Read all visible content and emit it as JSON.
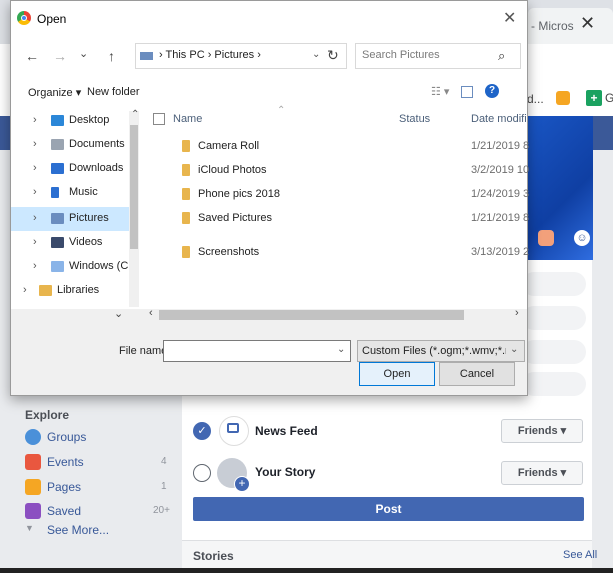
{
  "browser": {
    "tab_title": "- Micros",
    "tab_close": "✕",
    "bookmark_overflow": "d...",
    "bookmark_letter": "G"
  },
  "facebook": {
    "explore_header": "Explore",
    "nav": [
      {
        "label": "Groups",
        "count": "",
        "icon": "groups-icon",
        "color": "#4a90d9"
      },
      {
        "label": "Events",
        "count": "4",
        "icon": "calendar-icon",
        "color": "#e9573f"
      },
      {
        "label": "Pages",
        "count": "1",
        "icon": "flag-icon",
        "color": "#f5a623"
      },
      {
        "label": "Saved",
        "count": "20+",
        "icon": "bookmark-icon",
        "color": "#8b4fc1"
      },
      {
        "label": "See More...",
        "count": "",
        "icon": "chevron-down-icon",
        "color": "#90949c"
      }
    ],
    "share_rows": [
      {
        "label": "News Feed",
        "checked": true,
        "audience": "Friends ▾"
      },
      {
        "label": "Your Story",
        "checked": false,
        "audience": "Friends ▾"
      }
    ],
    "post_label": "Post",
    "stories_title": "Stories",
    "see_all": "See All",
    "accent": "#4267b2"
  },
  "dialog": {
    "title": "Open",
    "close_glyph": "✕",
    "nav": {
      "back": "←",
      "forward": "→",
      "recent": "⌄",
      "up": "↑"
    },
    "address_path": "›  This PC  ›  Pictures  ›",
    "search_placeholder": "Search Pictures",
    "organize": "Organize ▾",
    "new_folder": "New folder",
    "tree": [
      {
        "label": "Desktop",
        "icon": "desktop-icon",
        "color": "#2b87d8",
        "selected": false
      },
      {
        "label": "Documents",
        "icon": "documents-icon",
        "color": "#9aa4b1",
        "selected": false
      },
      {
        "label": "Downloads",
        "icon": "downloads-icon",
        "color": "#2b6fd1",
        "selected": false
      },
      {
        "label": "Music",
        "icon": "music-icon",
        "color": "#2b6fd1",
        "selected": false
      },
      {
        "label": "Pictures",
        "icon": "pictures-icon",
        "color": "#6b8dbf",
        "selected": true
      },
      {
        "label": "Videos",
        "icon": "videos-icon",
        "color": "#3a4a6b",
        "selected": false
      },
      {
        "label": "Windows (C:)",
        "icon": "drive-icon",
        "color": "#8ab4e8",
        "selected": false
      },
      {
        "label": "Libraries",
        "icon": "libraries-icon",
        "color": "#e8b54d",
        "selected": false
      }
    ],
    "columns": {
      "name": "Name",
      "status": "Status",
      "date": "Date modifi"
    },
    "files": [
      {
        "name": "Camera Roll",
        "date": "1/21/2019 8"
      },
      {
        "name": "iCloud Photos",
        "date": "3/2/2019 10"
      },
      {
        "name": "Phone pics 2018",
        "date": "1/24/2019 3"
      },
      {
        "name": "Saved Pictures",
        "date": "1/21/2019 8"
      },
      {
        "name": "Screenshots",
        "date": "3/13/2019 2"
      }
    ],
    "file_name_label": "File name:",
    "file_name_value": "",
    "file_type": "Custom Files (*.ogm;*.wmv;*.mi",
    "open_label": "Open",
    "cancel_label": "Cancel"
  }
}
